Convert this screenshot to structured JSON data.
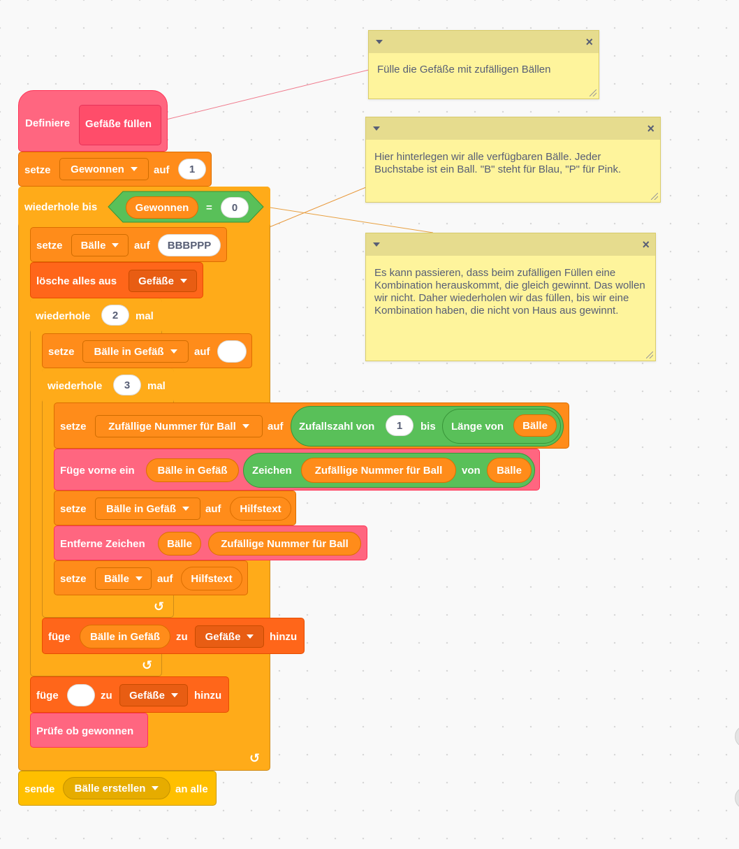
{
  "colors": {
    "variables": "#ff8c1a",
    "lists": "#ff661a",
    "control": "#ffab19",
    "my_blocks": "#ff6680",
    "operators": "#59c059",
    "events": "#ffbf00",
    "comment": "#fef49c"
  },
  "define": {
    "label": "Definiere",
    "proc": "Gefäße füllen"
  },
  "set_won": {
    "label": "setze",
    "var": "Gewonnen",
    "to": "auf",
    "value": "1"
  },
  "repeat_until": {
    "label": "wiederhole bis",
    "var": "Gewonnen",
    "eq": "=",
    "value": "0"
  },
  "set_balls": {
    "label": "setze",
    "var": "Bälle",
    "to": "auf",
    "value": "BBBPPP"
  },
  "delete_all": {
    "label": "lösche alles aus",
    "list": "Gefäße"
  },
  "repeat_outer": {
    "label": "wiederhole",
    "count": "2",
    "times": "mal"
  },
  "set_in_vessel": {
    "label": "setze",
    "var": "Bälle in Gefäß",
    "to": "auf"
  },
  "repeat_inner": {
    "label": "wiederhole",
    "count": "3",
    "times": "mal"
  },
  "set_random": {
    "label": "setze",
    "var": "Zufällige Nummer für Ball",
    "to": "auf",
    "random_label": "Zufallszahl von",
    "from": "1",
    "bis": "bis",
    "length_label": "Länge von",
    "length_var": "Bälle"
  },
  "insert_front": {
    "label": "Füge vorne ein",
    "var1": "Bälle in Gefäß",
    "letter_label": "Zeichen",
    "letter_var": "Zufällige Nummer für Ball",
    "of": "von",
    "of_var": "Bälle"
  },
  "set_vessel_help": {
    "label": "setze",
    "var": "Bälle in Gefäß",
    "to": "auf",
    "value": "Hilfstext"
  },
  "remove_char": {
    "label": "Entferne Zeichen",
    "var1": "Bälle",
    "var2": "Zufällige Nummer für Ball"
  },
  "set_balls_help": {
    "label": "setze",
    "var": "Bälle",
    "to": "auf",
    "value": "Hilfstext"
  },
  "add_vessel": {
    "label": "füge",
    "var": "Bälle in Gefäß",
    "to": "zu",
    "list": "Gefäße",
    "add": "hinzu"
  },
  "add_empty": {
    "label": "füge",
    "to": "zu",
    "list": "Gefäße",
    "add": "hinzu"
  },
  "check_won": {
    "label": "Prüfe ob gewonnen"
  },
  "broadcast": {
    "label": "sende",
    "message": "Bälle erstellen",
    "to_all": "an alle"
  },
  "comments": [
    {
      "text": "Fülle die Gefäße mit zufälligen Bällen"
    },
    {
      "text": "Hier hinterlegen wir alle verfügbaren Bälle. Jeder Buchstabe ist ein Ball. \"B\" steht für Blau, \"P\" für Pink."
    },
    {
      "text": "Es kann passieren, dass beim zufälligen Füllen eine Kombination herauskommt, die gleich gewinnt. Das wollen wir nicht. Daher wiederholen wir das füllen, bis wir eine Kombination haben, die nicht von Haus aus gewinnt."
    }
  ],
  "icons": {
    "repeat_arrow": "↺",
    "close": "×"
  }
}
